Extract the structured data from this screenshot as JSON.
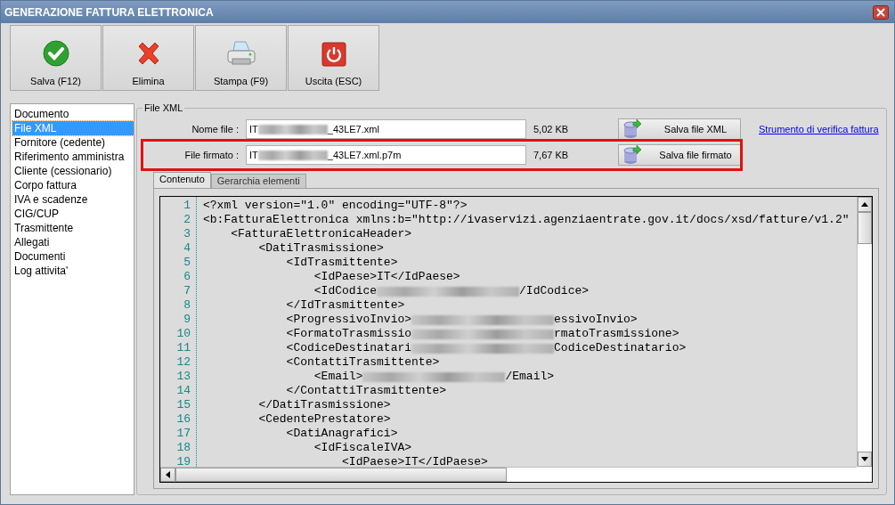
{
  "window": {
    "title": "GENERAZIONE FATTURA ELETTRONICA"
  },
  "toolbar": [
    {
      "label": "Salva (F12)",
      "kind": "save"
    },
    {
      "label": "Elimina",
      "kind": "delete"
    },
    {
      "label": "Stampa (F9)",
      "kind": "print"
    },
    {
      "label": "Uscita (ESC)",
      "kind": "exit"
    }
  ],
  "sidebar": {
    "items": [
      {
        "label": "Documento",
        "selected": false
      },
      {
        "label": "File XML",
        "selected": true
      },
      {
        "label": "Fornitore (cedente)",
        "selected": false
      },
      {
        "label": "Riferimento amministra",
        "selected": false
      },
      {
        "label": "Cliente (cessionario)",
        "selected": false
      },
      {
        "label": "Corpo fattura",
        "selected": false
      },
      {
        "label": "IVA e scadenze",
        "selected": false
      },
      {
        "label": "CIG/CUP",
        "selected": false
      },
      {
        "label": "Trasmittente",
        "selected": false
      },
      {
        "label": "Allegati",
        "selected": false
      },
      {
        "label": "Documenti",
        "selected": false
      },
      {
        "label": "Log attivita'",
        "selected": false
      }
    ]
  },
  "group": {
    "title": "File XML",
    "file_rows": [
      {
        "label": "Nome file :",
        "value_start": "IT",
        "value_end": "_43LE7.xml",
        "size": "5,02 KB",
        "button": "Salva file XML",
        "highlighted": false
      },
      {
        "label": "File firmato :",
        "value_start": "IT",
        "value_end": "_43LE7.xml.p7m",
        "size": "7,67 KB",
        "button": "Salva file firmato",
        "highlighted": true
      }
    ],
    "link": "Strumento di verifica fattura",
    "tabs": [
      {
        "label": "Contenuto",
        "selected": true
      },
      {
        "label": "Gerarchia elementi",
        "selected": false
      }
    ],
    "code_lines": [
      {
        "number": "1",
        "text": "<?xml version=\"1.0\" encoding=\"UTF-8\"?>"
      },
      {
        "number": "2",
        "text": "<b:FatturaElettronica xmlns:b=\"http://ivaservizi.agenziaentrate.gov.it/docs/xsd/fatture/v1.2\""
      },
      {
        "number": "3",
        "text": "    <FatturaElettronicaHeader>"
      },
      {
        "number": "4",
        "text": "        <DatiTrasmissione>"
      },
      {
        "number": "5",
        "text": "            <IdTrasmittente>"
      },
      {
        "number": "6",
        "text": "                <IdPaese>IT</IdPaese>"
      },
      {
        "number": "7",
        "text": "                <IdCodice",
        "after": "/IdCodice>"
      },
      {
        "number": "8",
        "text": "            </IdTrasmittente>"
      },
      {
        "number": "9",
        "text": "            <ProgressivoInvio>",
        "after": "essivoInvio>"
      },
      {
        "number": "10",
        "text": "            <FormatoTrasmissio",
        "after": "rmatoTrasmissione>"
      },
      {
        "number": "11",
        "text": "            <CodiceDestinatari",
        "after": "CodiceDestinatario>"
      },
      {
        "number": "12",
        "text": "            <ContattiTrasmittente>"
      },
      {
        "number": "13",
        "text": "                <Email>",
        "after": "/Email>"
      },
      {
        "number": "14",
        "text": "            </ContattiTrasmittente>"
      },
      {
        "number": "15",
        "text": "        </DatiTrasmissione>"
      },
      {
        "number": "16",
        "text": "        <CedentePrestatore>"
      },
      {
        "number": "17",
        "text": "            <DatiAnagrafici>"
      },
      {
        "number": "18",
        "text": "                <IdFiscaleIVA>"
      },
      {
        "number": "19",
        "text": "                    <IdPaese>IT</IdPaese>"
      }
    ]
  }
}
